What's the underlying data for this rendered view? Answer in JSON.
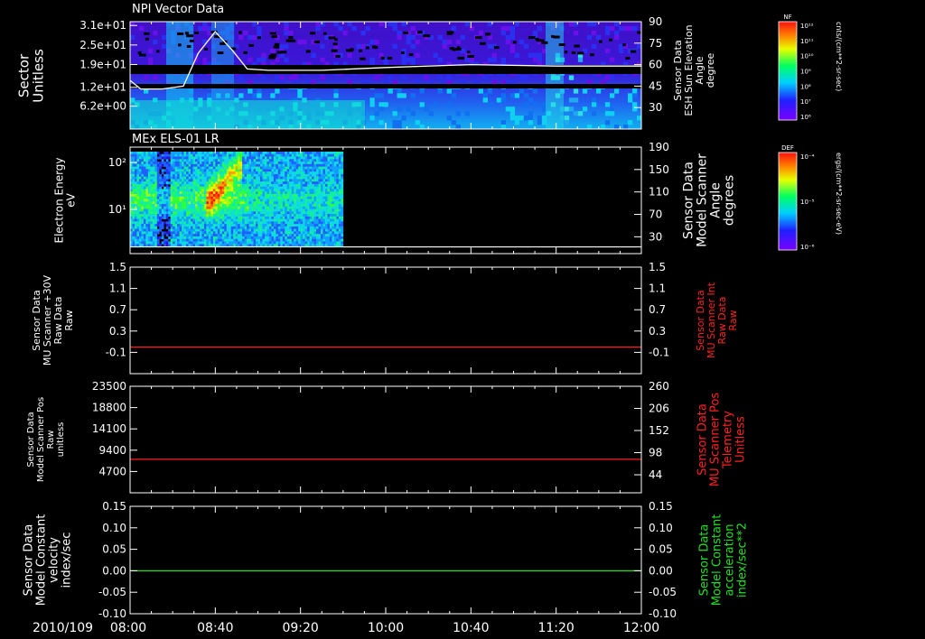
{
  "time_axis": {
    "date": "2010/109",
    "ticks": [
      "08:00",
      "08:40",
      "09:20",
      "10:00",
      "10:40",
      "11:20",
      "12:00"
    ]
  },
  "colors": {
    "white": "#ffffff",
    "red": "#ff2020",
    "green": "#20e020",
    "background": "#000000"
  },
  "chart_data": [
    {
      "type": "heatmap",
      "title": "NPI Vector Data",
      "ylabel_left": [
        "Sector",
        "Unitless"
      ],
      "yticks_left": [
        "3.1e+01",
        "2.5e+01",
        "1.9e+01",
        "1.2e+01",
        "6.2e+00"
      ],
      "ylabel_right": [
        "Sensor Data",
        "ESH Sun Elevation",
        "Angle",
        "degree"
      ],
      "yticks_right": [
        "90",
        "75",
        "60",
        "45",
        "30"
      ],
      "ylim_right": [
        15,
        90
      ],
      "overlay_line": {
        "name": "",
        "color": "#ffffff",
        "x": [
          "08:00",
          "08:05",
          "08:15",
          "08:25",
          "08:32",
          "08:40",
          "08:48",
          "08:55",
          "09:05",
          "09:30",
          "10:00",
          "10:40",
          "11:20",
          "12:00"
        ],
        "y": [
          49,
          43,
          43,
          45,
          68,
          83,
          70,
          57,
          56,
          56,
          58,
          60,
          59,
          59
        ]
      },
      "colorbar": {
        "label": "NF",
        "unit": "cnts/(cm**2-sr-sec)",
        "ticks": [
          "10¹²",
          "10¹¹",
          "10¹⁰",
          "10⁹",
          "10⁸",
          "10⁷",
          "10⁶"
        ]
      }
    },
    {
      "type": "heatmap",
      "title": "MEx ELS-01 LR",
      "ylabel_left": [
        "Electron Energy",
        "eV"
      ],
      "yticks_left": [
        "10²",
        "10¹"
      ],
      "ylabel_right": [
        "Sensor Data",
        "Model Scanner",
        "Angle",
        "degrees"
      ],
      "yticks_right": [
        "190",
        "150",
        "110",
        "70",
        "30"
      ],
      "ylim_right": [
        0,
        190
      ],
      "data_extent": [
        "08:00",
        "09:40"
      ],
      "overlay_line": {
        "name": "",
        "color": "#ffffff",
        "x": [
          "08:00",
          "09:40"
        ],
        "y": [
          12,
          12
        ]
      },
      "colorbar": {
        "label": "DEF",
        "unit": "ergs/(cm**2-sr-sec-eV)",
        "ticks": [
          "10⁻⁴",
          "10⁻⁵",
          "10⁻⁶"
        ]
      }
    },
    {
      "type": "line",
      "ylabel_left": [
        "Sensor Data",
        "MU Scanner +30V",
        "Raw Data",
        "Raw"
      ],
      "yticks_left": [
        "1.5",
        "1.1",
        "0.7",
        "0.3",
        "-0.1"
      ],
      "ylim": [
        -0.5,
        1.5
      ],
      "ylabel_right": [
        "Sensor Data",
        "MU Scanner Int",
        "Raw Data",
        "Raw"
      ],
      "yticks_right": [
        "1.5",
        "1.1",
        "0.7",
        "0.3",
        "-0.1"
      ],
      "series": [
        {
          "color": "#ff2020",
          "x": [
            "08:00",
            "12:00"
          ],
          "y": [
            0,
            0
          ]
        }
      ]
    },
    {
      "type": "line",
      "ylabel_left": [
        "Sensor Data",
        "Model Scanner Pos",
        "Raw",
        "unitless"
      ],
      "yticks_left": [
        "23500",
        "18800",
        "14100",
        "9400",
        "4700"
      ],
      "ylim": [
        0,
        23500
      ],
      "ylabel_right": [
        "Sensor Data",
        "MU Scanner Pos",
        "Telemetry",
        "Unitless"
      ],
      "yticks_right": [
        "260",
        "206",
        "152",
        "98",
        "44"
      ],
      "series": [
        {
          "color": "#ff2020",
          "x": [
            "08:00",
            "12:00"
          ],
          "y": [
            7400,
            7400
          ]
        }
      ]
    },
    {
      "type": "line",
      "ylabel_left": [
        "Sensor Data",
        "Model Constant",
        "velocity",
        "index/sec"
      ],
      "yticks_left": [
        "0.15",
        "0.10",
        "0.05",
        "0.00",
        "-0.05",
        "-0.10"
      ],
      "ylim": [
        -0.1,
        0.15
      ],
      "ylabel_right": [
        "Sensor Data",
        "Model Constant",
        "acceleration",
        "index/sec**2"
      ],
      "yticks_right": [
        "0.15",
        "0.10",
        "0.05",
        "0.00",
        "-0.05",
        "-0.10"
      ],
      "series": [
        {
          "color": "#20e020",
          "x": [
            "08:00",
            "12:00"
          ],
          "y": [
            0.0,
            0.0
          ]
        }
      ]
    }
  ]
}
